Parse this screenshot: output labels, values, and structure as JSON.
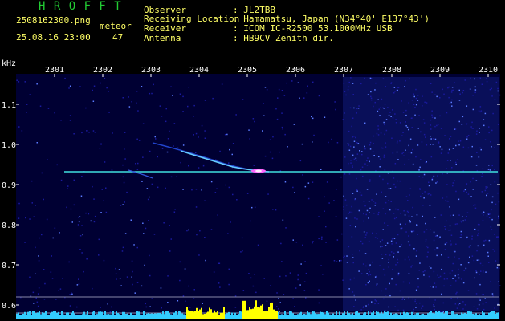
{
  "app": {
    "title": "H R O F F T",
    "filename": "2508162300.png",
    "datetime": "25.08.16 23:00",
    "meteor_label": "meteor",
    "meteor_count": "47"
  },
  "info": {
    "rows": [
      {
        "label": "Observer",
        "value": ": JL2TBB"
      },
      {
        "label": "Receiving Location",
        "value": ": Hamamatsu, Japan (N34°40' E137°43')"
      },
      {
        "label": "Receiver",
        "value": ": ICOM IC-R2500 53.1000MHz USB"
      },
      {
        "label": "Antenna",
        "value": ": HB9CV Zenith dir."
      }
    ]
  },
  "spectrogram": {
    "y_unit": "kHz",
    "x_ticks": [
      "2301",
      "2302",
      "2303",
      "2304",
      "2305",
      "2306",
      "2307",
      "2308",
      "2309",
      "2310"
    ],
    "y_ticks": [
      "1.1",
      "1.0",
      "0.9",
      "0.8",
      "0.7",
      "0.6"
    ],
    "carrier_khz": 0.93,
    "colors": {
      "background": "#000033",
      "noise_low": "#1a1a9e",
      "noise_high": "#5a7aff",
      "carrier": "#40e0e0",
      "echo_hot": "#ff66ff",
      "level_bar": "#33ccff",
      "level_peak": "#ffff00",
      "axis_text": "#ffffff"
    }
  }
}
